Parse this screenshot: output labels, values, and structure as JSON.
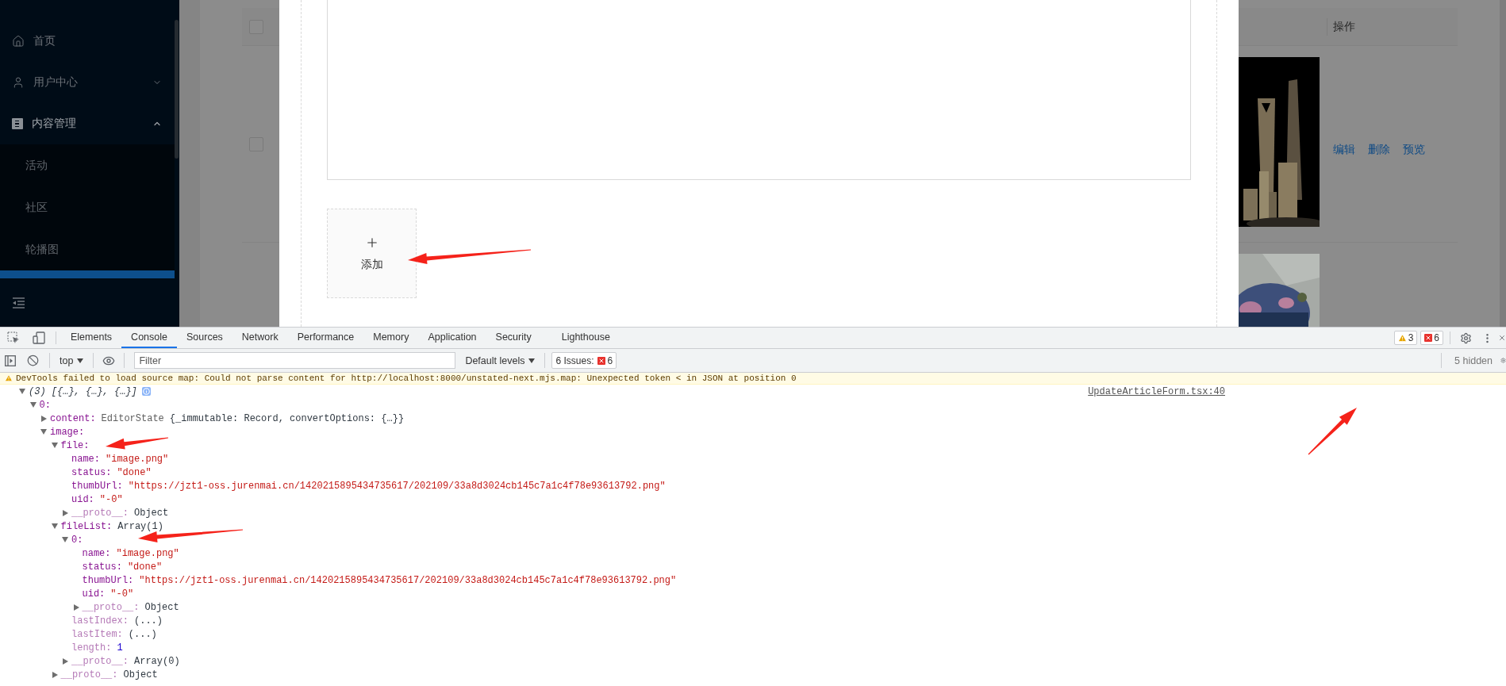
{
  "sidebar": {
    "items": [
      {
        "label": "首页"
      },
      {
        "label": "用户中心",
        "expanded": false
      },
      {
        "label": "内容管理",
        "expanded": true,
        "children": [
          {
            "label": "活动",
            "selected": false
          },
          {
            "label": "社区",
            "selected": false
          },
          {
            "label": "轮播图",
            "selected": false
          }
        ]
      }
    ]
  },
  "table": {
    "header": {
      "checked": false,
      "columns": [
        "操作"
      ]
    },
    "rows": [
      {
        "checked": false,
        "image": {
          "kind": "picture"
        },
        "actions": [
          "编辑",
          "删除",
          "预览"
        ]
      },
      {
        "image": {
          "kind": "picture"
        }
      }
    ]
  },
  "modal": {
    "upload": {
      "label": "添加"
    }
  },
  "devtools": {
    "tabs": [
      {
        "label": "Elements",
        "selected": false
      },
      {
        "label": "Console",
        "selected": true
      },
      {
        "label": "Sources",
        "selected": false
      },
      {
        "label": "Network",
        "selected": false
      },
      {
        "label": "Performance",
        "selected": false
      },
      {
        "label": "Memory",
        "selected": false
      },
      {
        "label": "Application",
        "selected": false
      },
      {
        "label": "Security",
        "selected": false
      },
      {
        "label": "Lighthouse",
        "selected": false
      }
    ],
    "warnings": "3",
    "errors": "6",
    "toolbar": {
      "context": "top",
      "filter_placeholder": "Filter",
      "levels": "Default levels",
      "issues_label": "6 Issues:",
      "issues_count": "6",
      "hidden": "5 hidden"
    },
    "console": {
      "warning": "DevTools failed to load source map: Could not parse content for http://localhost:8000/unstated-next.mjs.map: Unexpected token < in JSON at position 0",
      "message": {
        "summary": "(3) [{…}, {…}, {…}]",
        "source": "UpdateArticleForm.tsx:40",
        "expanded": true,
        "children": [
          {
            "key": "0:",
            "expanded": true,
            "children": [
              {
                "key": "content:",
                "class_name": "EditorState",
                "value": "{_immutable: Record, convertOptions: {…}}",
                "expanded": false
              },
              {
                "key": "image:",
                "expanded": true,
                "children": [
                  {
                    "key": "file:",
                    "expanded": true,
                    "children": [
                      {
                        "key": "name:",
                        "value": "\"image.png\"",
                        "kind": "string"
                      },
                      {
                        "key": "status:",
                        "value": "\"done\"",
                        "kind": "string"
                      },
                      {
                        "key": "thumbUrl:",
                        "value": "\"https://jzt1-oss.jurenmai.cn/1420215895434735617/202109/33a8d3024cb145c7a1c4f78e93613792.png\"",
                        "kind": "string"
                      },
                      {
                        "key": "uid:",
                        "value": "\"-0\"",
                        "kind": "string"
                      },
                      {
                        "key": "__proto__:",
                        "value": "Object",
                        "dim": true,
                        "expanded": false
                      }
                    ]
                  },
                  {
                    "key": "fileList:",
                    "value": "Array(1)",
                    "expanded": true,
                    "children": [
                      {
                        "key": "0:",
                        "expanded": true,
                        "children": [
                          {
                            "key": "name:",
                            "value": "\"image.png\"",
                            "kind": "string"
                          },
                          {
                            "key": "status:",
                            "value": "\"done\"",
                            "kind": "string"
                          },
                          {
                            "key": "thumbUrl:",
                            "value": "\"https://jzt1-oss.jurenmai.cn/1420215895434735617/202109/33a8d3024cb145c7a1c4f78e93613792.png\"",
                            "kind": "string"
                          },
                          {
                            "key": "uid:",
                            "value": "\"-0\"",
                            "kind": "string"
                          },
                          {
                            "key": "__proto__:",
                            "value": "Object",
                            "dim": true,
                            "expanded": false
                          }
                        ]
                      },
                      {
                        "key": "lastIndex:",
                        "value": "(...)",
                        "dim": true
                      },
                      {
                        "key": "lastItem:",
                        "value": "(...)",
                        "dim": true
                      },
                      {
                        "key": "length:",
                        "value": "1",
                        "kind": "number",
                        "dim": true
                      },
                      {
                        "key": "__proto__:",
                        "value": "Array(0)",
                        "dim": true,
                        "expanded": false
                      }
                    ]
                  },
                  {
                    "key": "__proto__:",
                    "value": "Object",
                    "dim": true,
                    "expanded": false
                  }
                ]
              }
            ]
          }
        ]
      }
    }
  }
}
